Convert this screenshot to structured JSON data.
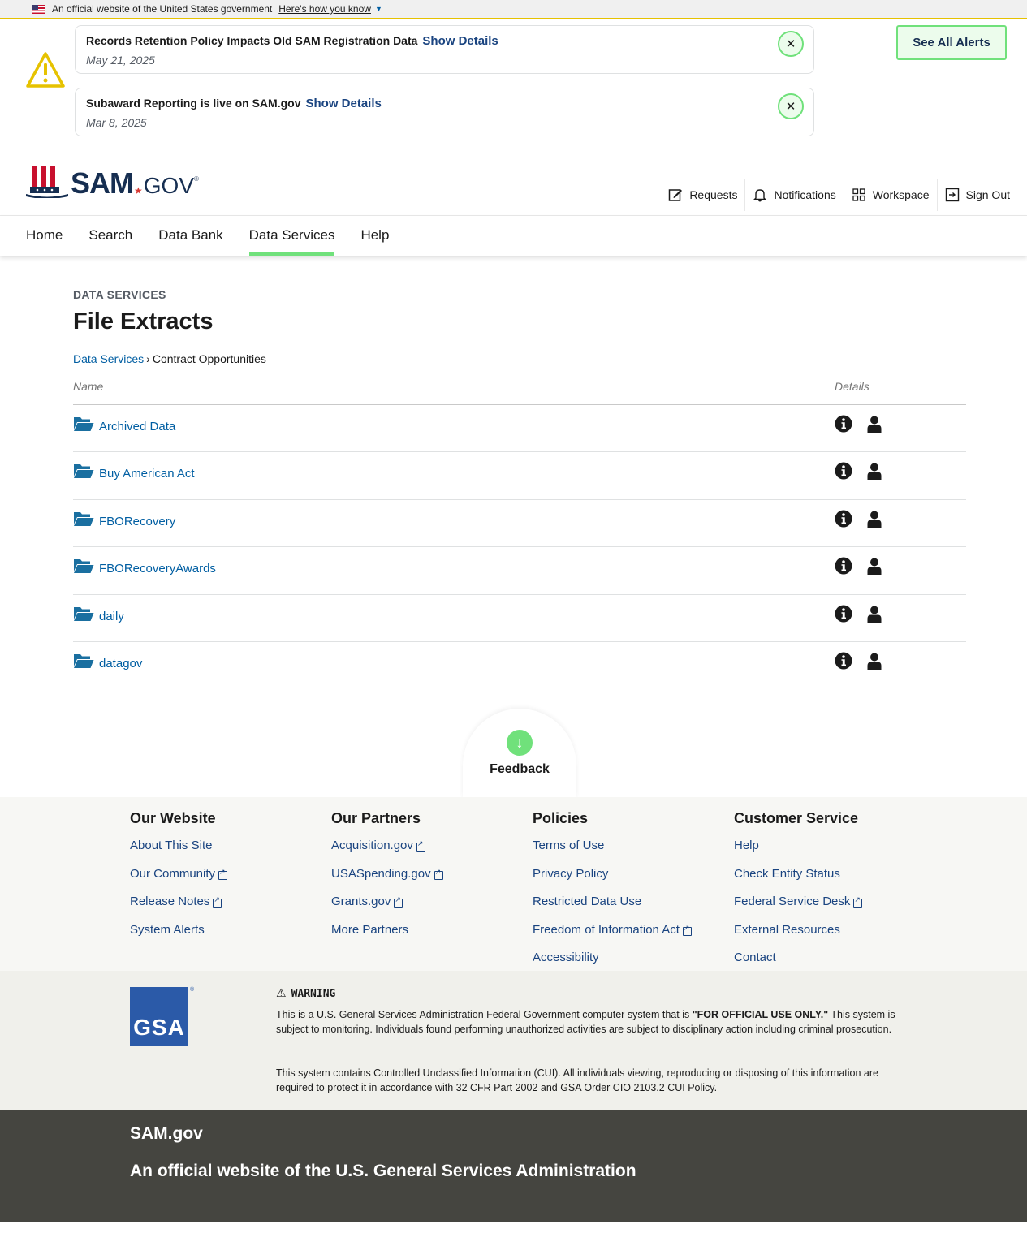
{
  "gov_banner": {
    "text": "An official website of the United States government",
    "link": "Here's how you know"
  },
  "alerts": {
    "items": [
      {
        "title": "Records Retention Policy Impacts Old SAM Registration Data",
        "action": "Show Details",
        "date": "May 21, 2025"
      },
      {
        "title": "Subaward Reporting is live on SAM.gov",
        "action": "Show Details",
        "date": "Mar 8, 2025"
      }
    ],
    "see_all": "See All Alerts"
  },
  "header": {
    "logo_sam": "SAM",
    "logo_gov": "GOV",
    "util_nav": [
      "Requests",
      "Notifications",
      "Workspace",
      "Sign Out"
    ]
  },
  "nav": {
    "items": [
      "Home",
      "Search",
      "Data Bank",
      "Data Services",
      "Help"
    ],
    "active": "Data Services"
  },
  "page": {
    "kicker": "DATA SERVICES",
    "title": "File Extracts",
    "breadcrumb": {
      "root": "Data Services",
      "current": "Contract Opportunities"
    }
  },
  "table": {
    "headers": {
      "name": "Name",
      "details": "Details"
    },
    "rows": [
      "Archived Data",
      "Buy American Act",
      "FBORecovery",
      "FBORecoveryAwards",
      "daily",
      "datagov"
    ]
  },
  "feedback": {
    "label": "Feedback"
  },
  "footer": {
    "columns": [
      {
        "heading": "Our Website",
        "links": [
          {
            "label": "About This Site",
            "external": false
          },
          {
            "label": "Our Community",
            "external": true
          },
          {
            "label": "Release Notes",
            "external": true
          },
          {
            "label": "System Alerts",
            "external": false
          }
        ]
      },
      {
        "heading": "Our Partners",
        "links": [
          {
            "label": "Acquisition.gov",
            "external": true
          },
          {
            "label": "USASpending.gov",
            "external": true
          },
          {
            "label": "Grants.gov",
            "external": true
          },
          {
            "label": "More Partners",
            "external": false
          }
        ]
      },
      {
        "heading": "Policies",
        "links": [
          {
            "label": "Terms of Use",
            "external": false
          },
          {
            "label": "Privacy Policy",
            "external": false
          },
          {
            "label": "Restricted Data Use",
            "external": false
          },
          {
            "label": "Freedom of Information Act",
            "external": true
          },
          {
            "label": "Accessibility",
            "external": false
          }
        ]
      },
      {
        "heading": "Customer Service",
        "links": [
          {
            "label": "Help",
            "external": false
          },
          {
            "label": "Check Entity Status",
            "external": false
          },
          {
            "label": "Federal Service Desk",
            "external": true
          },
          {
            "label": "External Resources",
            "external": false
          },
          {
            "label": "Contact",
            "external": false
          }
        ]
      }
    ],
    "gsa_logo": "GSA",
    "warning_heading": "WARNING",
    "warning_p1_before": "This is a U.S. General Services Administration Federal Government computer system that is ",
    "warning_p1_bold": "\"FOR OFFICIAL USE ONLY.\"",
    "warning_p1_after": " This system is subject to monitoring. Individuals found performing unauthorized activities are subject to disciplinary action including criminal prosecution.",
    "warning_p2": "This system contains Controlled Unclassified Information (CUI). All individuals viewing, reproducing or disposing of this information are required to protect it in accordance with 32 CFR Part 2002 and GSA Order CIO 2103.2 CUI Policy.",
    "brand": "SAM.gov",
    "tagline": "An official website of the U.S. General Services Administration"
  },
  "colors": {
    "accent_green": "#70e17b",
    "link_blue": "#005ea2",
    "navy": "#162e51",
    "alert_yellow": "#e6c200"
  }
}
